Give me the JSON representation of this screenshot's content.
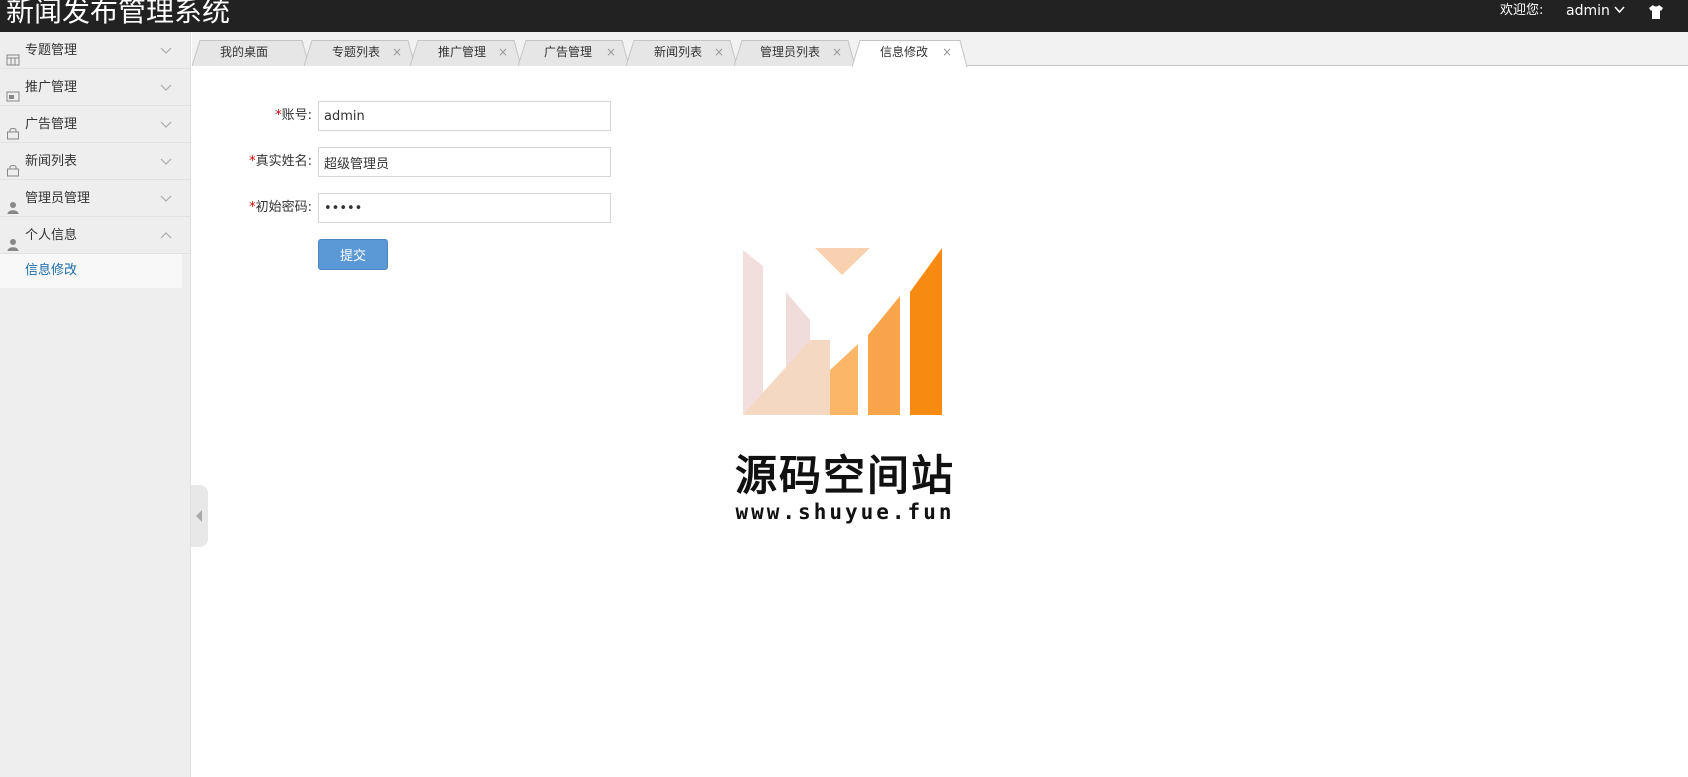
{
  "app": {
    "title": "新闻发布管理系统",
    "welcome": "欢迎您:",
    "username": "admin"
  },
  "sidebar": {
    "items": [
      {
        "label": "专题管理",
        "icon": "grid-icon",
        "expanded": false
      },
      {
        "label": "推广管理",
        "icon": "image-icon",
        "expanded": false
      },
      {
        "label": "广告管理",
        "icon": "bag-icon",
        "expanded": false
      },
      {
        "label": "新闻列表",
        "icon": "bag-icon",
        "expanded": false
      },
      {
        "label": "管理员管理",
        "icon": "user-icon",
        "expanded": false
      },
      {
        "label": "个人信息",
        "icon": "user-icon",
        "expanded": true
      }
    ],
    "subitems": [
      {
        "label": "信息修改"
      }
    ]
  },
  "tabs": [
    {
      "label": "我的桌面",
      "closable": false
    },
    {
      "label": "专题列表",
      "closable": true
    },
    {
      "label": "推广管理",
      "closable": true
    },
    {
      "label": "广告管理",
      "closable": true
    },
    {
      "label": "新闻列表",
      "closable": true
    },
    {
      "label": "管理员列表",
      "closable": true
    },
    {
      "label": "信息修改",
      "closable": true,
      "active": true
    }
  ],
  "tab_close_glyph": "×",
  "form": {
    "required_mark": "*",
    "account_label": "账号:",
    "account_value": "admin",
    "realname_label": "真实姓名:",
    "realname_value": "超级管理员",
    "password_label": "初始密码:",
    "password_value": "admin",
    "submit_label": "提交"
  },
  "watermark": {
    "name": "源码空间站",
    "url": "www.shuyue.fun"
  },
  "colors": {
    "topbar": "#222222",
    "sidebar": "#eeeeee",
    "accent_link": "#1a6ca8",
    "button": "#5a98d6",
    "required": "#cc0000"
  }
}
